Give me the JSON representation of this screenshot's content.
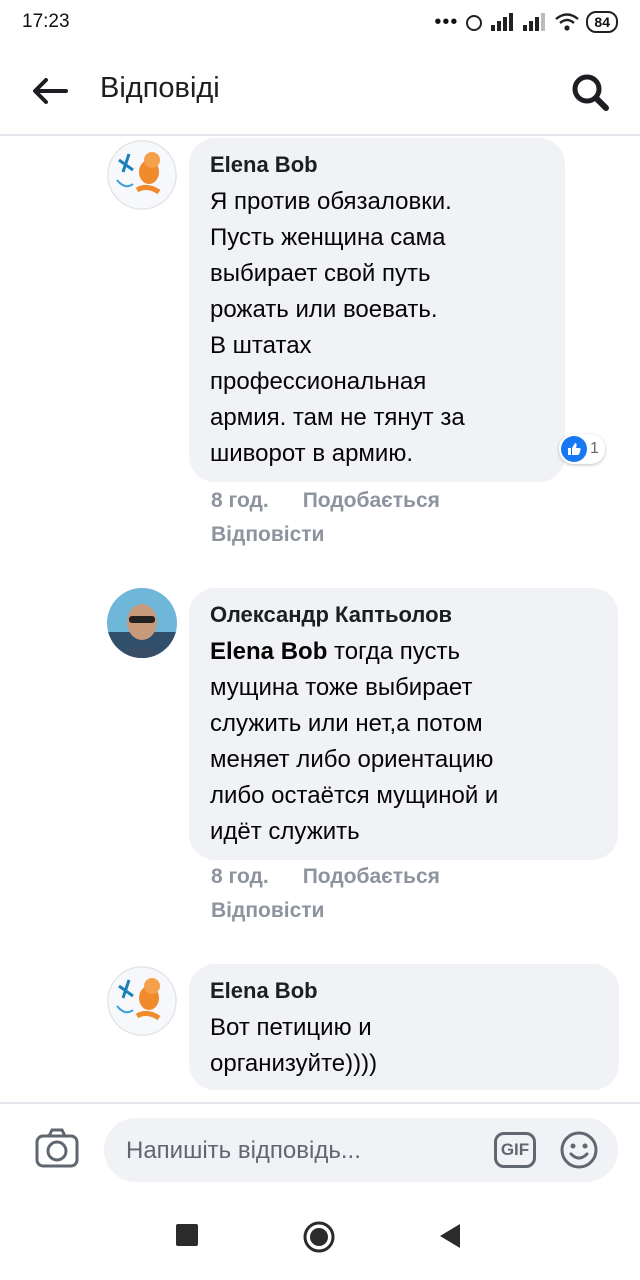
{
  "status_bar": {
    "time": "17:23",
    "battery": "84"
  },
  "header": {
    "title": "Відповіді"
  },
  "comments": [
    {
      "author": "Elena Bob",
      "text": "Я против обязаловки.\nПусть женщина сама\nвыбирает свой путь\nрожать или воевать.\nВ штатах\nпрофессиональная\nармия. там не тянут за\nшиворот в армию.",
      "time": "8 год.",
      "like_label": "Подобається",
      "reply_label": "Відповісти",
      "reaction_count": "1"
    },
    {
      "author": "Олександр Каптьолов",
      "mention": "Elena Bob",
      "text": " тогда пусть\nмущина тоже выбирает\nслужить или нет,а потом\nменяет либо ориентацию\nлибо остаётся мущиной и\nидёт служить",
      "time": "8 год.",
      "like_label": "Подобається",
      "reply_label": "Відповісти"
    },
    {
      "author": "Elena Bob",
      "text": "Вот петицию и\nорганизуйте))))"
    }
  ],
  "composer": {
    "placeholder": "Напишіть відповідь...",
    "gif_label": "GIF"
  },
  "icons": {
    "back": "arrow-left",
    "search": "magnifier",
    "camera": "camera",
    "emoji": "smiley",
    "like": "thumbs-up"
  },
  "colors": {
    "accent": "#1877f2",
    "bubble": "#f0f2f5",
    "meta": "#8d949e"
  }
}
